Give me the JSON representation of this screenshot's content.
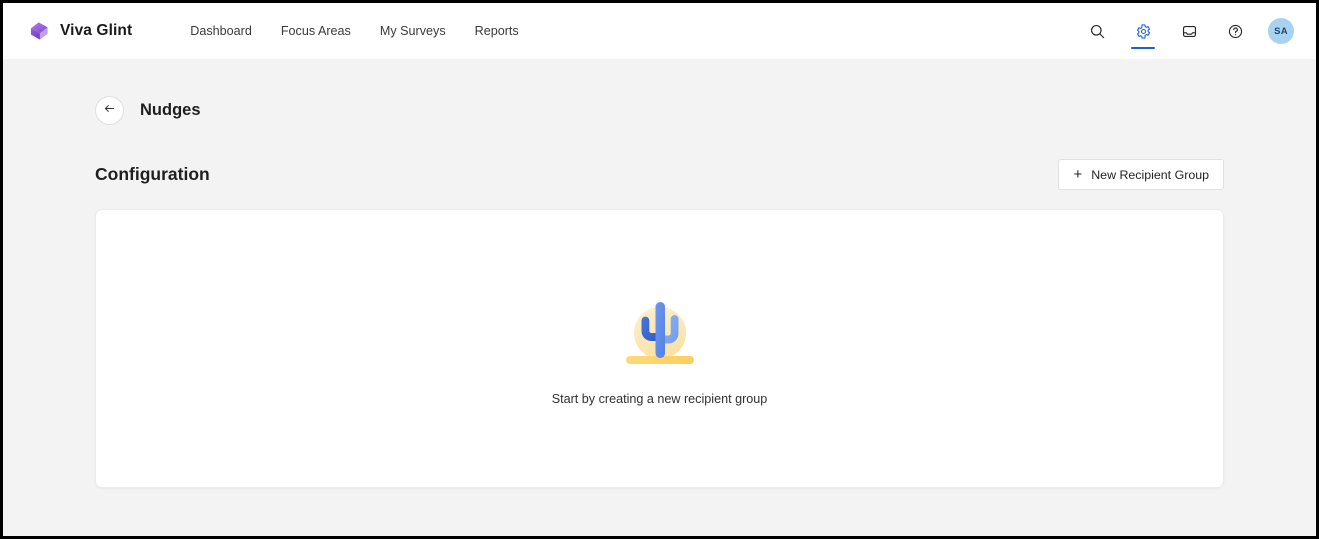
{
  "header": {
    "brand": {
      "logo_icon": "viva-glint-diamond-logo",
      "name": "Viva Glint",
      "logo_color": "#9a5cd0"
    },
    "nav_links": [
      {
        "label": "Dashboard"
      },
      {
        "label": "Focus Areas"
      },
      {
        "label": "My Surveys"
      },
      {
        "label": "Reports"
      }
    ],
    "actions": [
      {
        "icon": "search-icon",
        "active": false
      },
      {
        "icon": "gear-icon",
        "active": true
      },
      {
        "icon": "inbox-icon",
        "active": false
      },
      {
        "icon": "help-icon",
        "active": false
      }
    ],
    "active_accent_color": "#1f5fd0",
    "avatar": {
      "initials": "SA",
      "background_color": "#a8d3f0",
      "text_color": "#20486b"
    }
  },
  "page": {
    "back_icon": "arrow-left-icon",
    "title": "Nudges",
    "section_title": "Configuration",
    "new_group_button": {
      "label": "New Recipient Group",
      "icon": "plus-icon"
    },
    "empty_state": {
      "illustration": "cactus-desert-illustration",
      "message": "Start by creating a new recipient group",
      "colors": {
        "sun": "#fbe8b4",
        "ground": "#fcd667",
        "cactus_light": "#7ba5ea",
        "cactus_main": "#5b87e8",
        "cactus_dark": "#3868cc"
      }
    }
  }
}
